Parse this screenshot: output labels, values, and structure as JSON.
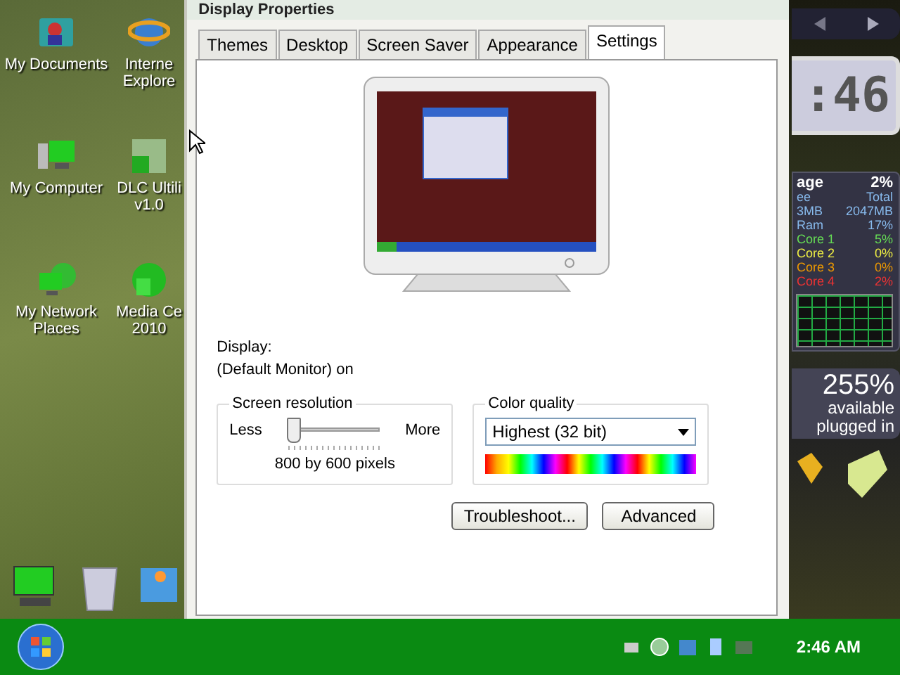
{
  "desktop_icons": [
    {
      "kind": "docs",
      "lines": [
        "My Documents"
      ]
    },
    {
      "kind": "ie",
      "lines": [
        "Interne",
        "Explore"
      ]
    },
    {
      "kind": "computer",
      "lines": [
        "My Computer"
      ]
    },
    {
      "kind": "app",
      "lines": [
        "DLC Ultili",
        "v1.0"
      ]
    },
    {
      "kind": "network",
      "lines": [
        "My Network",
        "Places"
      ]
    },
    {
      "kind": "media",
      "lines": [
        "Media Ce",
        "2010"
      ]
    }
  ],
  "window": {
    "title": "Display Properties"
  },
  "tabs": [
    {
      "label": "Themes",
      "selected": false
    },
    {
      "label": "Desktop",
      "selected": false
    },
    {
      "label": "Screen Saver",
      "selected": false
    },
    {
      "label": "Appearance",
      "selected": false
    },
    {
      "label": "Settings",
      "selected": true
    }
  ],
  "display": {
    "label": "Display:",
    "value": "(Default Monitor) on"
  },
  "resolution": {
    "title": "Screen resolution",
    "less": "Less",
    "more": "More",
    "level": 0,
    "reading": "800 by 600 pixels"
  },
  "color_quality": {
    "title": "Color quality",
    "value": "Highest (32 bit)"
  },
  "buttons": [
    "Troubleshoot...",
    "Advanced"
  ],
  "clock_gadget": {
    "time": ":46"
  },
  "cpu_gadget": {
    "title": "age",
    "total": "2%",
    "rows": [
      {
        "label": "ee",
        "value": "Total",
        "color": "#88bbee"
      },
      {
        "label": "3MB",
        "value": "2047MB",
        "color": "#88bbee"
      },
      {
        "label": "Ram",
        "value": "17%",
        "color": "#88bbee"
      },
      {
        "label": "Core 1",
        "value": "5%",
        "color": "#66dd55"
      },
      {
        "label": "Core 2",
        "value": "0%",
        "color": "#eeee44"
      },
      {
        "label": "Core 3",
        "value": "0%",
        "color": "#ee9900"
      },
      {
        "label": "Core 4",
        "value": "2%",
        "color": "#ee3333"
      }
    ]
  },
  "battery_gadget": {
    "percent": "255%",
    "status": "available",
    "power": "plugged in"
  },
  "taskbar": {
    "clock": "2:46 AM"
  }
}
